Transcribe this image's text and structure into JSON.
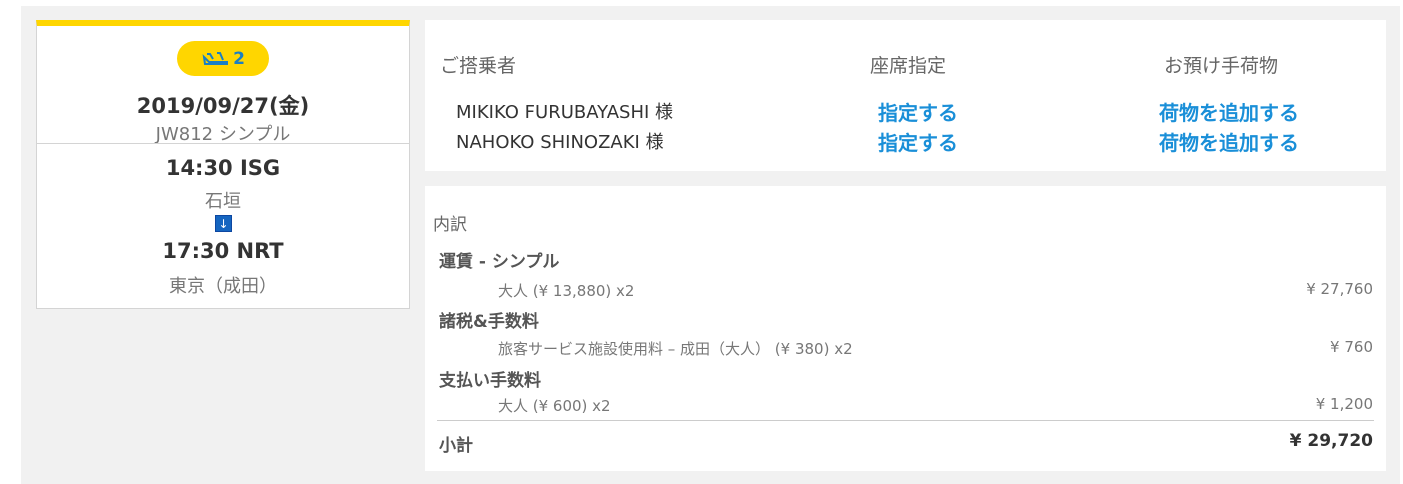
{
  "flight": {
    "badge_count": "2",
    "badge_icon": "plane-landing-icon",
    "date": "2019/09/27(金)",
    "flight_no": "JW812 シンプル",
    "departure_time": "14:30 ISG",
    "departure_city": "石垣",
    "arrow_icon": "↓",
    "arrival_time": "17:30 NRT",
    "arrival_city": "東京（成田）"
  },
  "passengers": {
    "header_passenger": "ご搭乗者",
    "header_seat": "座席指定",
    "header_baggage": "お預け手荷物",
    "list": [
      {
        "name": "MIKIKO FURUBAYASHI 様",
        "seat_link": "指定する",
        "baggage_link": "荷物を追加する"
      },
      {
        "name": "NAHOKO SHINOZAKI 様",
        "seat_link": "指定する",
        "baggage_link": "荷物を追加する"
      }
    ]
  },
  "breakdown": {
    "title": "内訳",
    "categories": [
      {
        "label": "運賃 - シンプル",
        "item": "大人 (¥ 13,880) x2",
        "amount": "¥ 27,760"
      },
      {
        "label": "諸税&手数料",
        "item": "旅客サービス施設使用料 – 成田（大人） (¥ 380) x2",
        "amount": "¥ 760"
      },
      {
        "label": "支払い手数料",
        "item": "大人 (¥ 600) x2",
        "amount": "¥ 1,200"
      }
    ],
    "subtotal_label": "小計",
    "subtotal_amount": "¥ 29,720"
  },
  "colors": {
    "accent_yellow": "#ffd600",
    "link_blue": "#1a8fd8",
    "badge_text": "#1a7fc4"
  }
}
